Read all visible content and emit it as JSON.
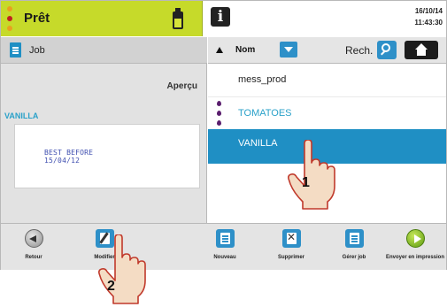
{
  "status": {
    "state_label": "Prêt",
    "state_colors": [
      "#e8a020",
      "#c02020",
      "#e8a020"
    ],
    "accent_color": "#c6da2a",
    "date": "16/10/14",
    "time": "11:43:30",
    "info_icon": "info-icon",
    "cartridge_icon": "ink-cartridge-icon"
  },
  "left_panel": {
    "section_label": "Job",
    "preview_label": "Aperçu",
    "selected_job_name": "VANILLA",
    "preview_lines": [
      "BEST BEFORE",
      "15/04/12"
    ]
  },
  "list": {
    "sort_label": "Nom",
    "search_label": "Rech.",
    "selected_color": "#1f8fc4",
    "jobs": [
      {
        "name": "mess_prod",
        "has_ink_icon": false
      },
      {
        "name": "TOMATOES",
        "has_ink_icon": true
      },
      {
        "name": "VANILLA",
        "has_ink_icon": true,
        "selected": true
      }
    ]
  },
  "toolbar": {
    "items": [
      {
        "label": "Retour",
        "icon": "back-arrow-icon"
      },
      {
        "label": "Modifier",
        "icon": "edit-job-icon"
      },
      {
        "label": "Nouveau",
        "icon": "new-job-icon"
      },
      {
        "label": "Supprimer",
        "icon": "delete-job-icon"
      },
      {
        "label": "Gérer job",
        "icon": "manage-job-icon"
      },
      {
        "label": "Envoyer en impression",
        "icon": "send-to-print-icon"
      }
    ]
  },
  "hints": {
    "step_1": "1",
    "step_2": "2"
  }
}
